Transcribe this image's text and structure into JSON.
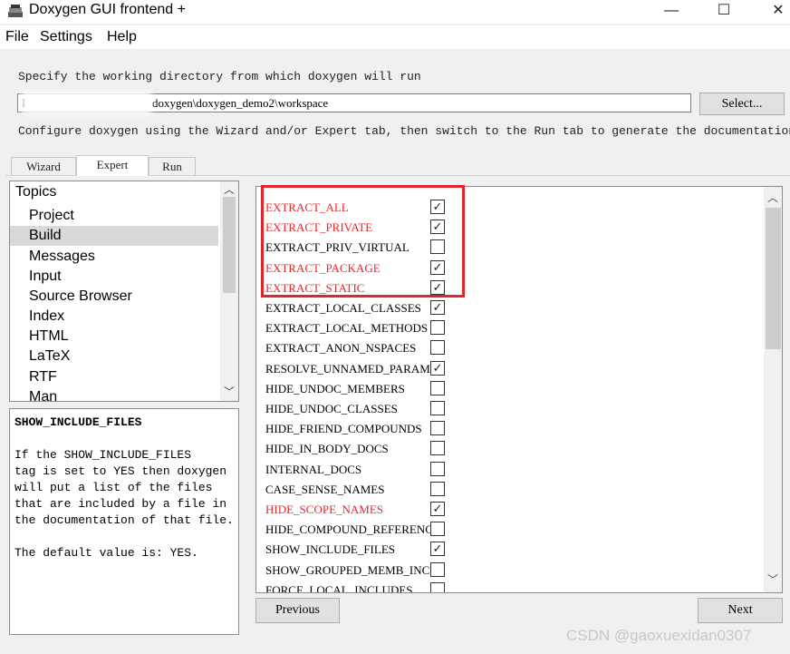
{
  "window": {
    "title": "Doxygen GUI frontend +",
    "minimize": "—",
    "maximize": "☐",
    "close": "✕"
  },
  "menu": [
    "File",
    "Settings",
    "Help"
  ],
  "working_dir": {
    "label": "Specify the working directory from which doxygen will run",
    "value": "doxygen\\doxygen_demo2\\workspace",
    "value_prefix": "L",
    "select_button": "Select..."
  },
  "configure_hint": "Configure doxygen using the Wizard and/or Expert tab, then switch to the Run tab to generate the documentation",
  "tabs": [
    "Wizard",
    "Expert",
    "Run"
  ],
  "active_tab": "Expert",
  "topics": {
    "header": "Topics",
    "items": [
      "Project",
      "Build",
      "Messages",
      "Input",
      "Source Browser",
      "Index",
      "HTML",
      "LaTeX",
      "RTF",
      "Man"
    ],
    "selected": "Build"
  },
  "help": {
    "title": "SHOW_INCLUDE_FILES",
    "lines": [
      "If the SHOW_INCLUDE_FILES",
      "tag is set to YES then doxygen",
      "will put a list of the files",
      "that are included by a file in",
      "the documentation of that file."
    ],
    "default": "The default value is: YES."
  },
  "options": [
    {
      "name": "EXTRACT_ALL",
      "checked": true,
      "modified": true
    },
    {
      "name": "EXTRACT_PRIVATE",
      "checked": true,
      "modified": true
    },
    {
      "name": "EXTRACT_PRIV_VIRTUAL",
      "checked": false,
      "modified": false
    },
    {
      "name": "EXTRACT_PACKAGE",
      "checked": true,
      "modified": true
    },
    {
      "name": "EXTRACT_STATIC",
      "checked": true,
      "modified": true
    },
    {
      "name": "EXTRACT_LOCAL_CLASSES",
      "checked": true,
      "modified": false
    },
    {
      "name": "EXTRACT_LOCAL_METHODS",
      "checked": false,
      "modified": false
    },
    {
      "name": "EXTRACT_ANON_NSPACES",
      "checked": false,
      "modified": false
    },
    {
      "name": "RESOLVE_UNNAMED_PARAMS",
      "checked": true,
      "modified": false
    },
    {
      "name": "HIDE_UNDOC_MEMBERS",
      "checked": false,
      "modified": false
    },
    {
      "name": "HIDE_UNDOC_CLASSES",
      "checked": false,
      "modified": false
    },
    {
      "name": "HIDE_FRIEND_COMPOUNDS",
      "checked": false,
      "modified": false
    },
    {
      "name": "HIDE_IN_BODY_DOCS",
      "checked": false,
      "modified": false
    },
    {
      "name": "INTERNAL_DOCS",
      "checked": false,
      "modified": false
    },
    {
      "name": "CASE_SENSE_NAMES",
      "checked": false,
      "modified": false
    },
    {
      "name": "HIDE_SCOPE_NAMES",
      "checked": true,
      "modified": true
    },
    {
      "name": "HIDE_COMPOUND_REFERENCE",
      "checked": false,
      "modified": false
    },
    {
      "name": "SHOW_INCLUDE_FILES",
      "checked": true,
      "modified": false
    },
    {
      "name": "SHOW_GROUPED_MEMB_INC",
      "checked": false,
      "modified": false
    },
    {
      "name": "FORCE_LOCAL_INCLUDES",
      "checked": false,
      "modified": false
    }
  ],
  "buttons": {
    "previous": "Previous",
    "next": "Next"
  },
  "watermark": "CSDN @gaoxuexidan0307",
  "colors": {
    "modified_option": "#e8262b",
    "highlight_box": "#e0262b"
  }
}
